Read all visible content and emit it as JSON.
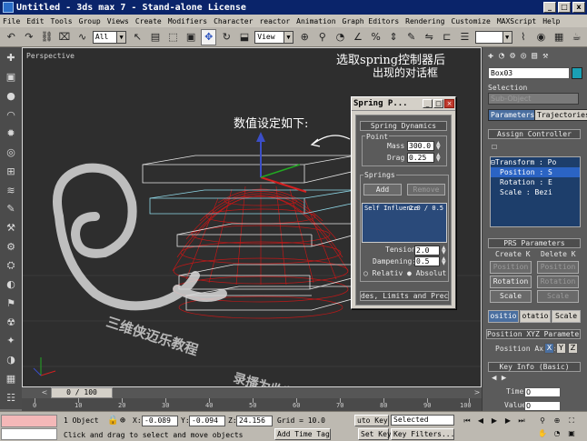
{
  "window": {
    "title": "Untitled - 3ds max 7  - Stand-alone License",
    "min_label": "_",
    "max_label": "□",
    "close_label": "x"
  },
  "menu": [
    "File",
    "Edit",
    "Tools",
    "Group",
    "Views",
    "Create",
    "Modifiers",
    "Character",
    "reactor",
    "Animation",
    "Graph Editors",
    "Rendering",
    "Customize",
    "MAXScript",
    "Help"
  ],
  "toolbar": {
    "selection_filter": "All",
    "ref_coord": "View",
    "named_sel": ""
  },
  "viewport": {
    "label": "Perspective"
  },
  "timeslider": {
    "label": "0 / 100",
    "left_arrow": "<",
    "right_arrow": ">"
  },
  "trackbar": {
    "ticks": [
      "0",
      "10",
      "20",
      "30",
      "40",
      "50",
      "60",
      "70",
      "80",
      "90",
      "100"
    ]
  },
  "status": {
    "objects": "1 Object",
    "x_label": "X:",
    "x_value": "-0.089",
    "y_label": "Y:",
    "y_value": "-0.094",
    "z_label": "Z:",
    "z_value": "24.156",
    "grid": "Grid = 10.0",
    "prompt": "Click and drag to select and move objects",
    "add_time_tag": "Add Time Tag",
    "auto_key": "uto Key",
    "selected": "Selected",
    "set_key": "Set Key",
    "key_filters": "Key Filters..."
  },
  "cmdpanel": {
    "object_name": "Box03",
    "object_color": "#1aa0b4",
    "selection_label": "Selection",
    "subobject": "Sub-Object",
    "tab_parameters": "Parameters",
    "tab_trajectories": "Trajectories",
    "rollout_assign": "Assign Controller",
    "tree": [
      "Transform : Po",
      "Position : S",
      "Rotation : E",
      "Scale : Bezi"
    ],
    "rollout_prs": "PRS Parameters",
    "create_key": "Create K",
    "delete_key": "Delete K",
    "position_btn": "Position",
    "rotation_btn": "Rotation",
    "scale_btn": "Scale",
    "tab_position": "ositio",
    "tab_rotation": "otatio",
    "tab_scale": "Scale",
    "rollout_xyz": "Position XYZ Parameters",
    "position_axis_label": "Position Axis:",
    "axes": [
      "X",
      "Y",
      "Z"
    ],
    "rollout_keyinfo": "Key Info (Basic)",
    "time_label": "Time:",
    "time_value": "0",
    "value_label": "Value",
    "value_value": "0"
  },
  "spring_dialog": {
    "title": "Spring P...",
    "rollout": "Spring Dynamics",
    "point_label": "Point",
    "mass_label": "Mass",
    "mass_value": "300.0",
    "drag_label": "Drag",
    "drag_value": "0.25",
    "springs_label": "Springs",
    "add_btn": "Add",
    "remove_btn": "Remove",
    "list_item_name": "Self Influence",
    "list_item_value": "2.0 / 0.5",
    "tension_label": "Tension:",
    "tension_value": "2.0",
    "dampening_label": "Dampening:",
    "dampening_value": "0.5",
    "relative_label": "Relativ",
    "absolute_label": "Absolut",
    "bottom_rollout": "des, Limits and Precis"
  },
  "annotations": {
    "top_right": "选取spring控制器后",
    "top_right_2": "出现的对话框",
    "left_note": "数值设定如下:",
    "watermark1": "三维侠迈乐教程",
    "watermark2": "录播为收获指"
  },
  "colors": {
    "viewport_bg": "#2e2e2e",
    "sphere_wire": "#c01818",
    "box_wire": "#e6e6e6",
    "box_wire_selected": "#8fd8e8",
    "gizmo_y": "#3b4ec8",
    "gizmo_x": "#d42020",
    "gizmo_z": "#22a822"
  }
}
